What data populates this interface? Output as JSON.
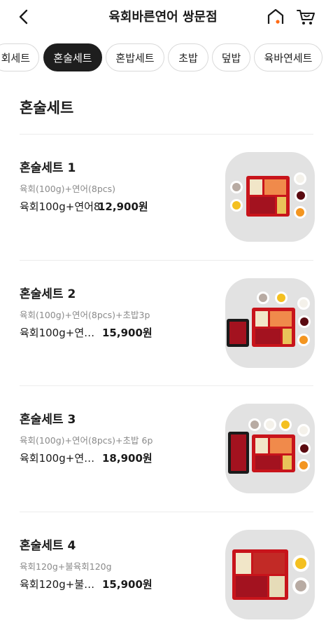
{
  "header": {
    "title": "육회바른연어 쌍문점"
  },
  "tabs": [
    {
      "label": "육회세트",
      "visible": "회세트"
    },
    {
      "label": "혼술세트",
      "active": true
    },
    {
      "label": "혼밥세트"
    },
    {
      "label": "초밥"
    },
    {
      "label": "덮밥"
    },
    {
      "label": "육바연세트"
    }
  ],
  "section": {
    "title": "혼술세트"
  },
  "items": [
    {
      "name": "혼술세트 1",
      "desc": "육회(100g)+연어(8pcs)",
      "short": "육회100g+연어8",
      "price": "12,900원"
    },
    {
      "name": "혼술세트 2",
      "desc": "육회(100g)+연어(8pcs)+초밥3p",
      "short": "육회100g+연…",
      "price": "15,900원"
    },
    {
      "name": "혼술세트 3",
      "desc": "육회(100g)+연어(8pcs)+초밥 6p",
      "short": "육회100g+연…",
      "price": "18,900원"
    },
    {
      "name": "혼술세트 4",
      "desc": "육회120g+불육회120g",
      "short": "육회120g+불…",
      "price": "15,900원"
    }
  ]
}
